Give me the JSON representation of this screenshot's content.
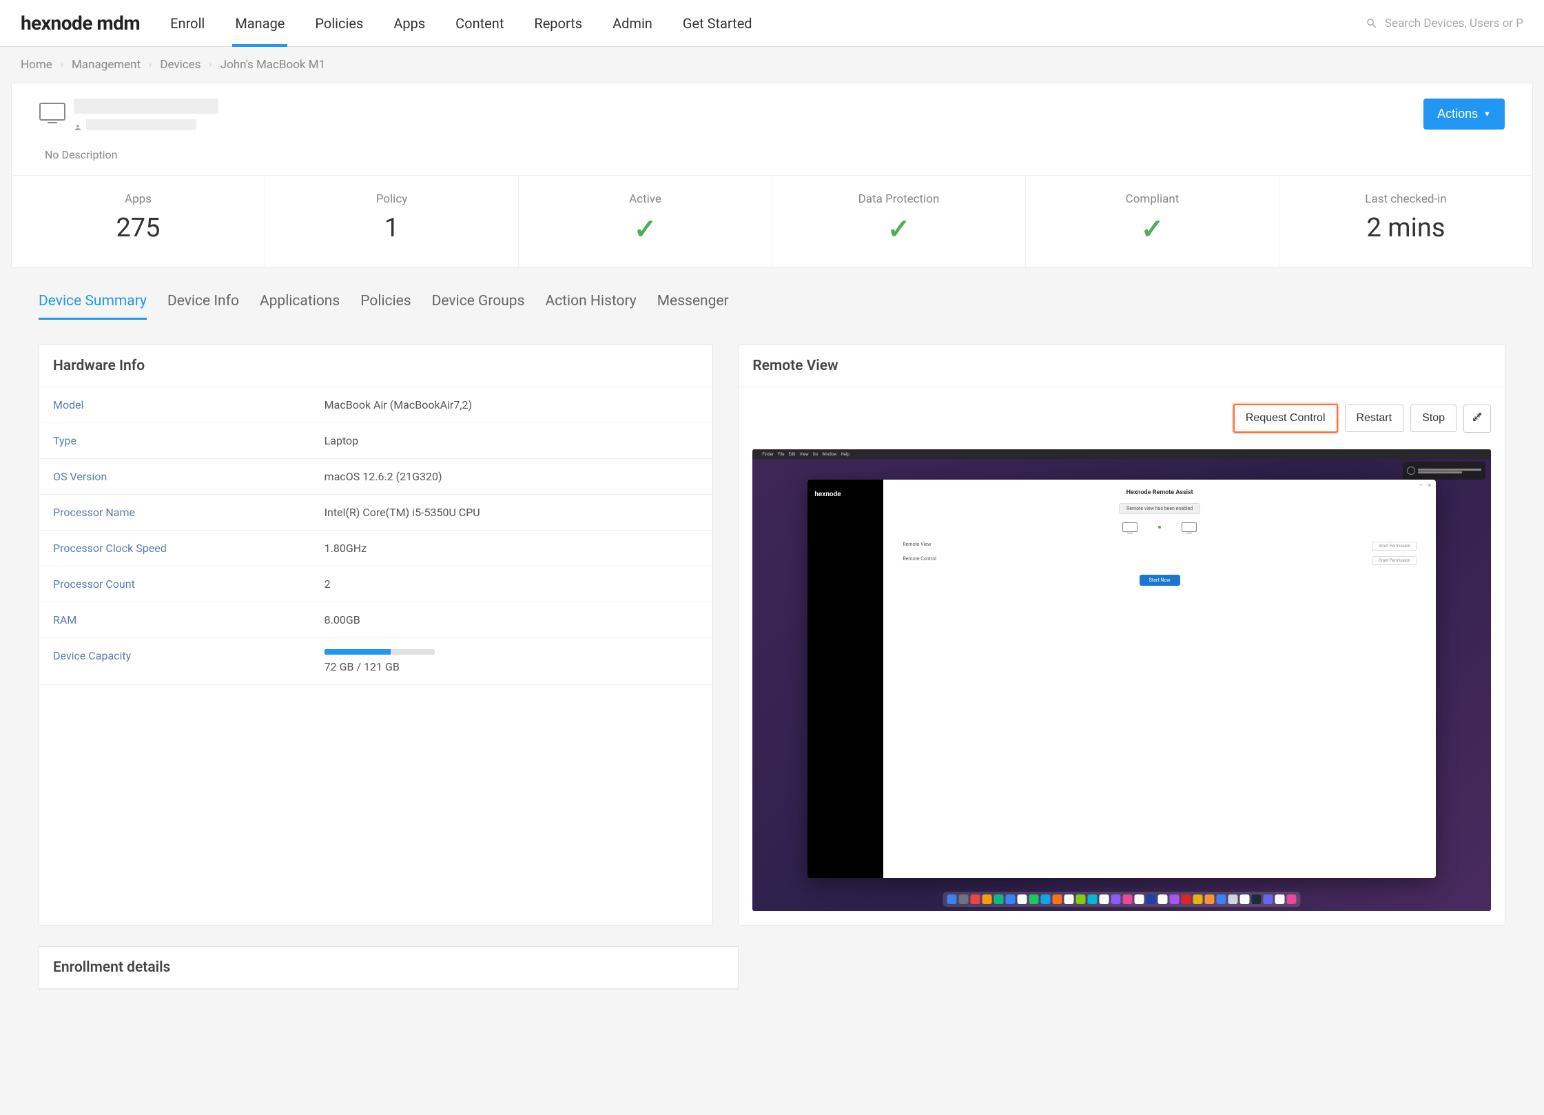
{
  "logo": "hexnode mdm",
  "nav": {
    "items": [
      "Enroll",
      "Manage",
      "Policies",
      "Apps",
      "Content",
      "Reports",
      "Admin",
      "Get Started"
    ],
    "active_index": 1
  },
  "search": {
    "placeholder": "Search Devices, Users or P"
  },
  "breadcrumb": [
    "Home",
    "Management",
    "Devices",
    "John's MacBook M1"
  ],
  "header": {
    "no_description": "No Description",
    "actions_label": "Actions"
  },
  "stats": {
    "apps": {
      "label": "Apps",
      "value": "275"
    },
    "policy": {
      "label": "Policy",
      "value": "1"
    },
    "active": {
      "label": "Active"
    },
    "data_protection": {
      "label": "Data Protection"
    },
    "compliant": {
      "label": "Compliant"
    },
    "last_checked": {
      "label": "Last checked-in",
      "value": "2 mins"
    }
  },
  "tabs": [
    "Device Summary",
    "Device Info",
    "Applications",
    "Policies",
    "Device Groups",
    "Action History",
    "Messenger"
  ],
  "hardware": {
    "title": "Hardware Info",
    "rows": [
      {
        "label": "Model",
        "value": "MacBook Air (MacBookAir7,2)"
      },
      {
        "label": "Type",
        "value": "Laptop"
      },
      {
        "label": "OS Version",
        "value": "macOS 12.6.2 (21G320)"
      },
      {
        "label": "Processor Name",
        "value": "Intel(R) Core(TM) i5-5350U CPU"
      },
      {
        "label": "Processor Clock Speed",
        "value": "1.80GHz"
      },
      {
        "label": "Processor Count",
        "value": "2"
      },
      {
        "label": "RAM",
        "value": "8.00GB"
      }
    ],
    "capacity": {
      "label": "Device Capacity",
      "value": "72 GB / 121 GB",
      "percent": 60
    }
  },
  "remote_view": {
    "title": "Remote View",
    "buttons": {
      "request": "Request Control",
      "restart": "Restart",
      "stop": "Stop"
    },
    "screen": {
      "menubar_items": [
        "Finder",
        "File",
        "Edit",
        "View",
        "Go",
        "Window",
        "Help"
      ],
      "sidebar_logo": "hexnode",
      "window_title": "Hexnode Remote Assist",
      "pill_text": "Remote view has been enabled",
      "status_rows": [
        {
          "label": "Remote View",
          "btn": "Grant Permission"
        },
        {
          "label": "Remote Control",
          "btn": "Grant Permission"
        }
      ],
      "blue_btn": "Start Now"
    }
  },
  "enrollment": {
    "title": "Enrollment details"
  },
  "dock_colors": [
    "#3b82f6",
    "#6b7280",
    "#ef4444",
    "#f59e0b",
    "#10b981",
    "#3b82f6",
    "#fff",
    "#22c55e",
    "#0ea5e9",
    "#f97316",
    "#fff",
    "#84cc16",
    "#06b6d4",
    "#fff",
    "#8b5cf6",
    "#ec4899",
    "#fff",
    "#1e40af",
    "#fff",
    "#a855f7",
    "#dc2626",
    "#eab308",
    "#fb923c",
    "#3b82f6",
    "#d1d5db",
    "#fff",
    "#1f2937",
    "#6366f1",
    "#fff",
    "#ec4899"
  ]
}
